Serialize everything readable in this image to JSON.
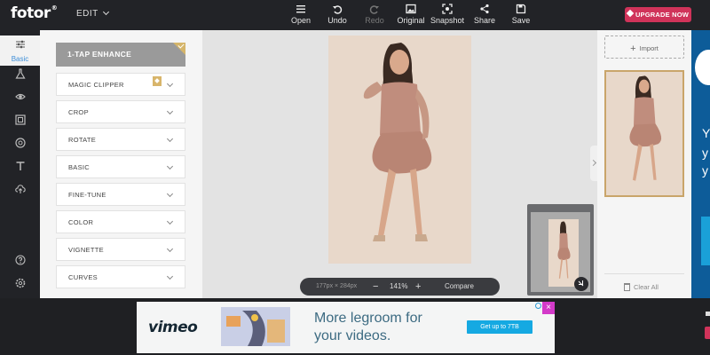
{
  "app": {
    "logo": "fotor",
    "logo_mark": "®",
    "edit_menu": "EDIT"
  },
  "toolbar": {
    "open": "Open",
    "undo": "Undo",
    "redo": "Redo",
    "original": "Original",
    "snapshot": "Snapshot",
    "share": "Share",
    "save": "Save",
    "upgrade": "UPGRADE NOW"
  },
  "iconbar": {
    "active_label": "Basic"
  },
  "panel": {
    "enhance": "1-TAP ENHANCE",
    "items": [
      {
        "label": "MAGIC CLIPPER"
      },
      {
        "label": "CROP"
      },
      {
        "label": "ROTATE"
      },
      {
        "label": "BASIC"
      },
      {
        "label": "FINE-TUNE"
      },
      {
        "label": "COLOR"
      },
      {
        "label": "VIGNETTE"
      },
      {
        "label": "CURVES"
      }
    ]
  },
  "canvas": {
    "dimensions": "177px × 284px",
    "zoom_minus": "−",
    "zoom": "141%",
    "zoom_plus": "+",
    "compare": "Compare"
  },
  "right_panel": {
    "import": "Import",
    "clear_all": "Clear All"
  },
  "ad": {
    "brand": "vimeo",
    "headline_line1": "More legroom for",
    "headline_line2": "your videos.",
    "cta": "Get up to 7TB",
    "close": "×"
  },
  "side_ad": {
    "letters": [
      "Y",
      "y",
      "y"
    ]
  },
  "colors": {
    "accent": "#d0335a",
    "gold": "#c9a56a",
    "ad_blue": "#15a9e2"
  }
}
